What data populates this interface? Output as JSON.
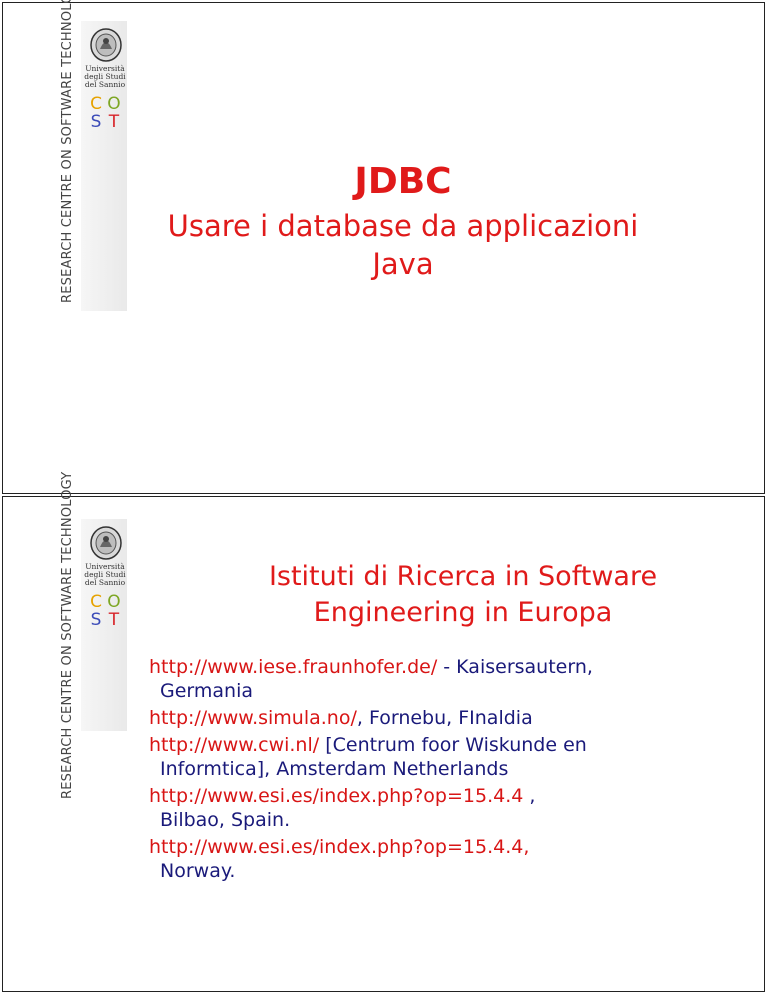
{
  "branding": {
    "side_label": "RESEARCH CENTRE ON SOFTWARE TECHNOLOGY",
    "university_line1": "Università",
    "university_line2": "degli Studi",
    "university_line3": "del Sannio",
    "cost_letters": [
      "C",
      "O",
      "S",
      "T"
    ]
  },
  "slide1": {
    "title": "JDBC",
    "subtitle_line1": "Usare i database da applicazioni",
    "subtitle_line2": "Java"
  },
  "slide2": {
    "heading_line1": "Istituti di Ricerca in Software",
    "heading_line2": "Engineering in Europa",
    "entries": [
      {
        "url": "http://www.iese.fraunhofer.de/",
        "rest": " - Kaisersautern,",
        "cont": "Germania"
      },
      {
        "url": "http://www.simula.no/",
        "rest": ", Fornebu, FInaldia",
        "cont": ""
      },
      {
        "url": "http://www.cwi.nl/",
        "rest": " [Centrum foor Wiskunde en",
        "cont": "Informtica], Amsterdam Netherlands"
      },
      {
        "url": "http://www.esi.es/index.php?op=15.4.4",
        "rest": " ,",
        "cont": "Bilbao, Spain."
      },
      {
        "url": "http://www.esi.es/index.php?op=15.4.4,",
        "rest": "",
        "cont": "Norway."
      }
    ]
  },
  "colors": {
    "title_red": "#e01a1a",
    "link_red": "#d81515",
    "text_navy": "#1a1a7a"
  }
}
